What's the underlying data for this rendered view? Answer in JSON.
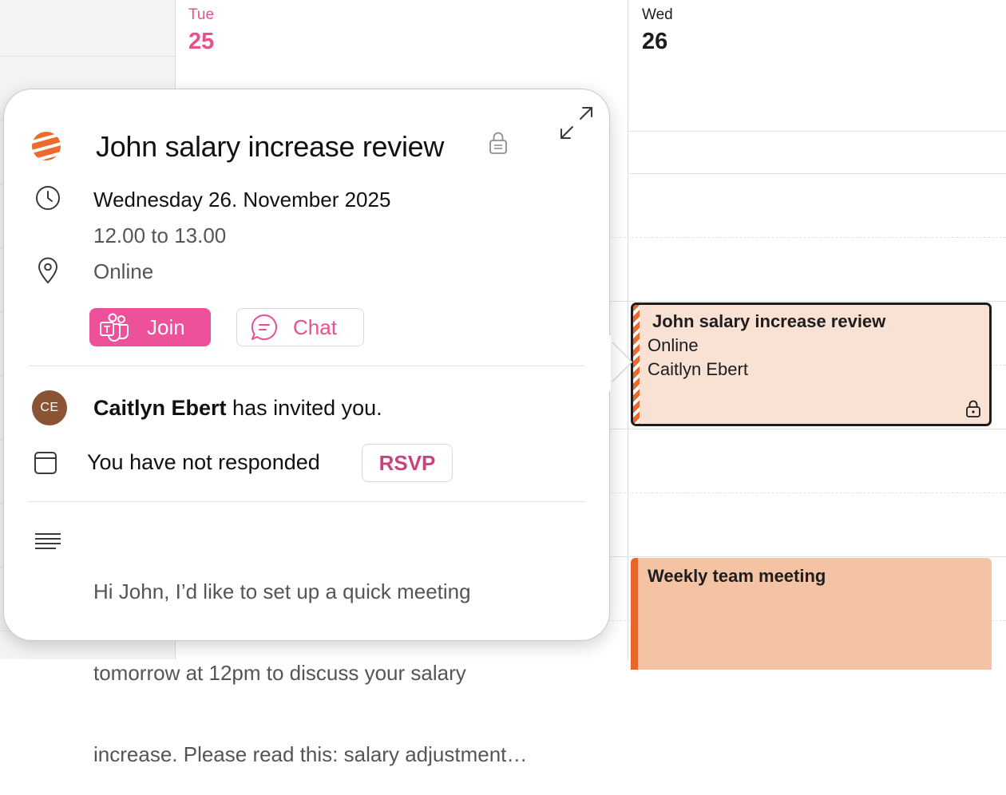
{
  "calendar": {
    "days": [
      {
        "name": "Tue",
        "number": "25",
        "is_today": true
      },
      {
        "name": "Wed",
        "number": "26",
        "is_today": false
      }
    ],
    "events": [
      {
        "title": "John salary increase review",
        "location": "Online",
        "organizer": "Caitlyn Ebert",
        "color": "#f9e1d4",
        "selected": true
      },
      {
        "title": "Weekly team meeting",
        "color": "#f4c3a4"
      }
    ]
  },
  "popover": {
    "title": "John salary increase review",
    "date": "Wednesday 26. November 2025",
    "time": "12.00 to 13.00",
    "location": "Online",
    "join_label": "Join",
    "chat_label": "Chat",
    "organizer_initials": "CE",
    "organizer_name": "Caitlyn Ebert",
    "invite_text": " has invited you.",
    "response_status": "You have not responded",
    "rsvp_label": "RSVP",
    "notes_lines": [
      "Hi John,    I’d like to set up a quick meeting",
      "tomorrow at 12pm to discuss your salary",
      "increase. Please read this: salary adjustment…"
    ]
  },
  "colors": {
    "accent": "#e8508f",
    "join_button": "#ec519a",
    "avatar": "#8a5334",
    "calendar_orange": "#ec6a2c"
  },
  "icons": [
    "calendar-color-icon",
    "private-lock-icon",
    "expand-icon",
    "clock-icon",
    "location-pin-icon",
    "teams-icon",
    "chat-bubble-icon",
    "calendar-icon",
    "notes-lines-icon"
  ]
}
